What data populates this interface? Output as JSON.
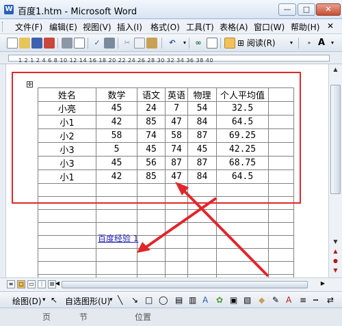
{
  "window": {
    "title": "百度1.htm - Microsoft Word",
    "controls": [
      "—",
      "□",
      "✕"
    ]
  },
  "menu": [
    "文件(F)",
    "编辑(E)",
    "视图(V)",
    "插入(I)",
    "格式(O)",
    "工具(T)",
    "表格(A)",
    "窗口(W)",
    "帮助(H)"
  ],
  "toolbar": {
    "reading_label": "阅读(R)"
  },
  "ruler": {
    "numbers": "1 2 1 2 4 6 8 10 12 14 16 18 20 22 24 26 28 30 32 34 36 38 40"
  },
  "table": {
    "headers": [
      "姓名",
      "数学",
      "语文",
      "英语",
      "物理",
      "个人平均值"
    ],
    "rows": [
      [
        "小亮",
        "45",
        "24",
        "7",
        "54",
        "32.5"
      ],
      [
        "小1",
        "42",
        "85",
        "47",
        "84",
        "64.5"
      ],
      [
        "小2",
        "58",
        "74",
        "58",
        "87",
        "69.25"
      ],
      [
        "小3",
        "5",
        "45",
        "74",
        "45",
        "42.25"
      ],
      [
        "小3",
        "45",
        "56",
        "87",
        "87",
        "68.75"
      ],
      [
        "小1",
        "42",
        "85",
        "47",
        "84",
        "64.5"
      ]
    ]
  },
  "link_text": "百度经验 1",
  "drawing_toolbar": {
    "draw_label": "绘图(D)",
    "autoshapes_label": "自选图形(U)"
  },
  "status": {
    "page": "页",
    "section": "节",
    "position": "位置"
  },
  "colors": {
    "annotation_red": "#e0262a",
    "link_blue": "#1a1ab0"
  }
}
